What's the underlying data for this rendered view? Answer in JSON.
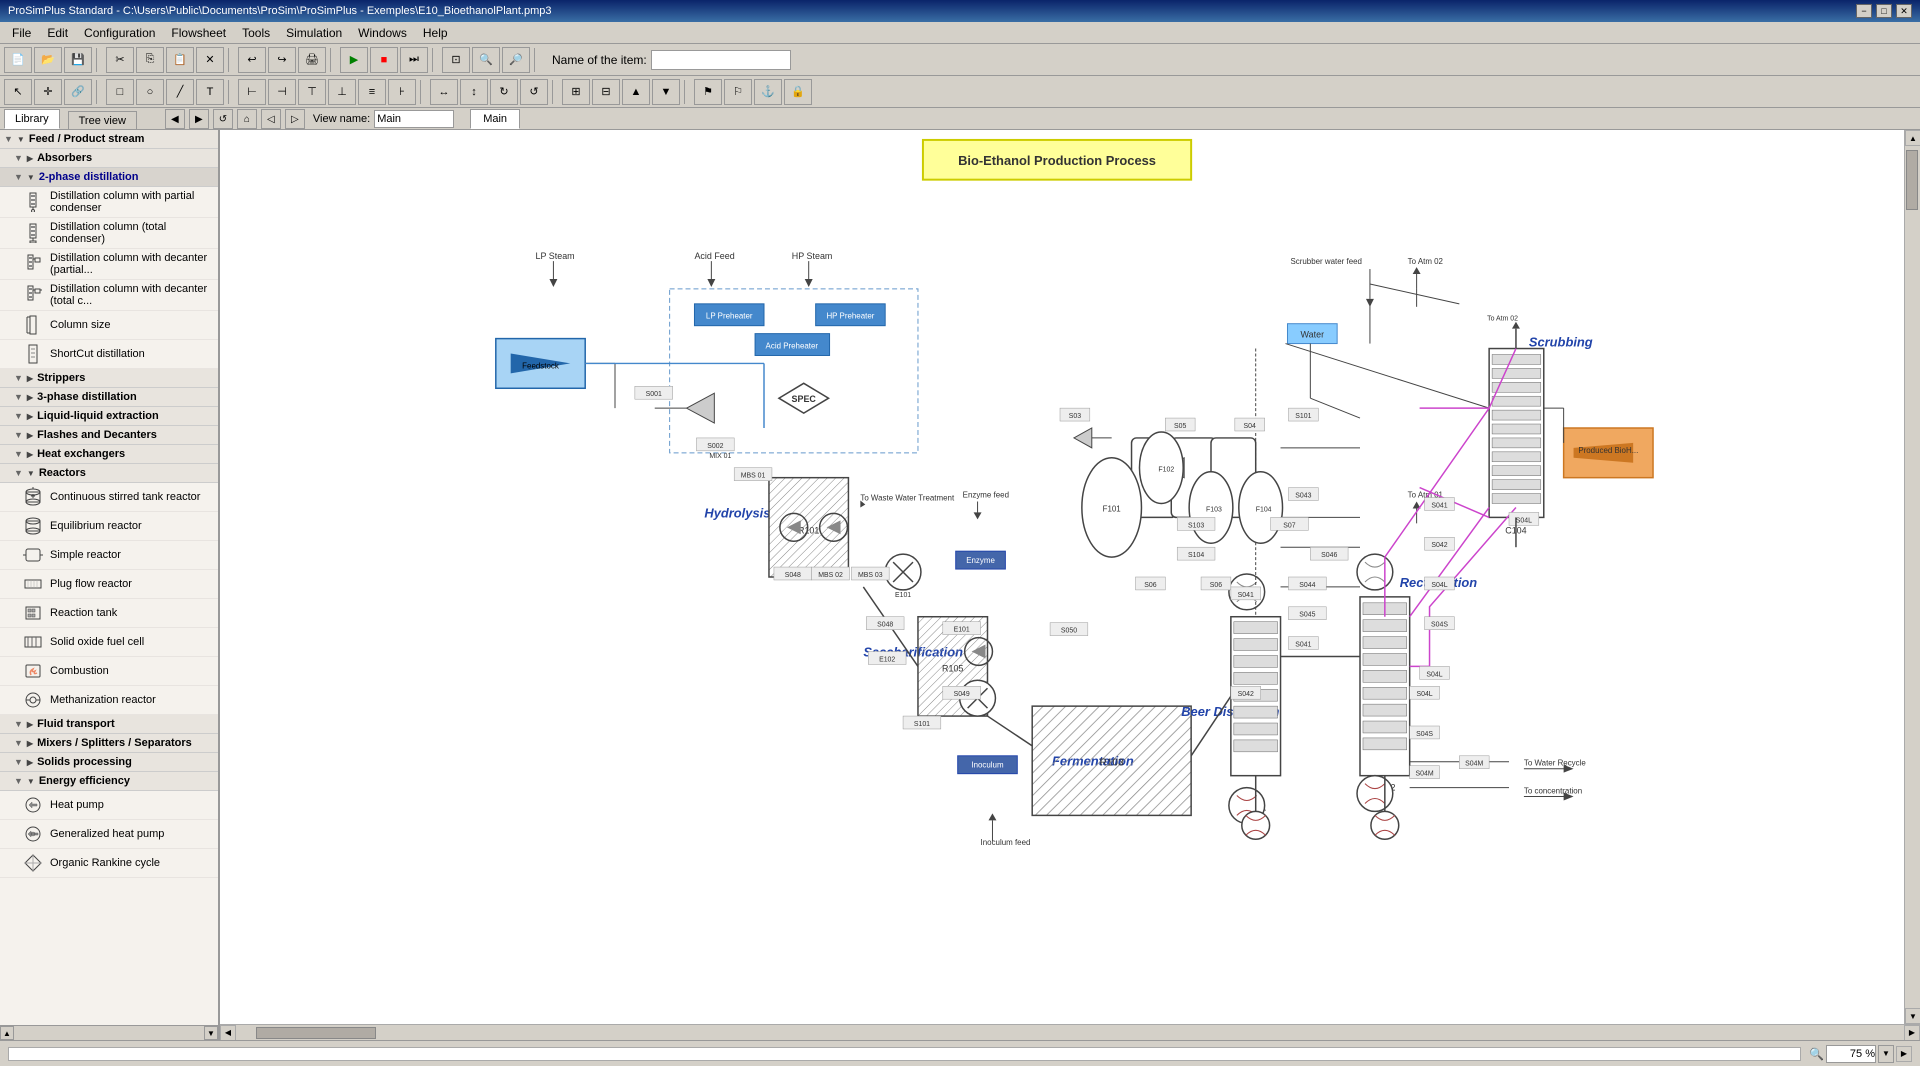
{
  "titlebar": {
    "title": "ProSimPlus Standard - C:\\Users\\Public\\Documents\\ProSim\\ProSimPlus - Exemples\\E10_BioethanolPlant.pmp3",
    "minimize": "−",
    "restore": "□",
    "close": "✕"
  },
  "menubar": {
    "items": [
      "File",
      "Edit",
      "Configuration",
      "Flowsheet",
      "Tools",
      "Simulation",
      "Windows",
      "Help"
    ]
  },
  "toolbar": {
    "name_of_item_label": "Name of the item:",
    "name_of_item_value": ""
  },
  "tabs": {
    "library_label": "Library",
    "tree_view_label": "Tree view",
    "main_tab_label": "Main"
  },
  "view": {
    "view_name_label": "View name:",
    "view_name_value": "Main"
  },
  "sidebar": {
    "categories": [
      {
        "id": "feed-product",
        "label": "Feed / Product stream",
        "expanded": true,
        "items": []
      },
      {
        "id": "absorbers",
        "label": "Absorbers",
        "expanded": false,
        "items": []
      },
      {
        "id": "2phase-distillation",
        "label": "2-phase distillation",
        "expanded": true,
        "sub": true,
        "items": [
          {
            "id": "dist-partial",
            "label": "Distillation column with partial condenser"
          },
          {
            "id": "dist-total",
            "label": "Distillation column (total condenser)"
          },
          {
            "id": "dist-decanter-partial",
            "label": "Distillation column with decanter (partial..."
          },
          {
            "id": "dist-decanter-total",
            "label": "Distillation column with decanter (total c..."
          },
          {
            "id": "column-size",
            "label": "Column size"
          },
          {
            "id": "shortcut",
            "label": "ShortCut distillation"
          }
        ]
      },
      {
        "id": "strippers",
        "label": "Strippers",
        "expanded": false,
        "items": []
      },
      {
        "id": "3phase-distillation",
        "label": "3-phase distillation",
        "expanded": false,
        "items": []
      },
      {
        "id": "liquid-liquid",
        "label": "Liquid-liquid extraction",
        "expanded": false,
        "items": []
      },
      {
        "id": "flashes",
        "label": "Flashes and Decanters",
        "expanded": false,
        "items": []
      },
      {
        "id": "heat-exchangers",
        "label": "Heat exchangers",
        "expanded": false,
        "items": []
      },
      {
        "id": "reactors",
        "label": "Reactors",
        "expanded": true,
        "items": [
          {
            "id": "cstr",
            "label": "Continuous stirred tank reactor"
          },
          {
            "id": "equilibrium-reactor",
            "label": "Equilibrium reactor"
          },
          {
            "id": "simple-reactor",
            "label": "Simple reactor"
          },
          {
            "id": "plug-flow",
            "label": "Plug flow reactor"
          },
          {
            "id": "reaction-tank",
            "label": "Reaction tank"
          },
          {
            "id": "solid-oxide",
            "label": "Solid oxide fuel cell"
          },
          {
            "id": "combustion",
            "label": "Combustion"
          },
          {
            "id": "methanation",
            "label": "Methanization reactor"
          }
        ]
      },
      {
        "id": "fluid-transport",
        "label": "Fluid transport",
        "expanded": false,
        "items": []
      },
      {
        "id": "mixers-splitters",
        "label": "Mixers / Splitters / Separators",
        "expanded": false,
        "items": []
      },
      {
        "id": "solids-processing",
        "label": "Solids processing",
        "expanded": false,
        "items": []
      },
      {
        "id": "energy-efficiency",
        "label": "Energy efficiency",
        "expanded": true,
        "items": [
          {
            "id": "heat-pump",
            "label": "Heat pump"
          },
          {
            "id": "generalized-heat-pump",
            "label": "Generalized heat pump"
          },
          {
            "id": "organic-rankine",
            "label": "Organic Rankine cycle"
          }
        ]
      }
    ]
  },
  "flowsheet": {
    "title": "Bio-Ethanol Production Process",
    "labels": {
      "hydrolysis": "Hydrolysis",
      "saccharification": "Saccharification",
      "fermentation": "Fermentation",
      "beer_distillation": "Beer Distillation",
      "scrubbing": "Scrubbing",
      "rectification": "Rectification",
      "lp_steam": "LP Steam",
      "hp_steam": "HP Steam",
      "acid_feed": "Acid Feed",
      "acid_preheater": "Acid Preheater",
      "lp_preheater": "LP Preheater",
      "hp_preheater": "HP Preheater",
      "enzyme": "Enzyme",
      "inoculum": "Inoculum",
      "inoculum_feed": "Inoculum feed",
      "to_waste_water": "To Waste Water Treatment",
      "enzyme_feed": "Enzyme feed",
      "to_atm_02": "To Atm 02",
      "to_atm_01": "To Atm 01",
      "produced_bioh": "Produced BioH...",
      "to_water_recycle": "To Water Recycle",
      "to_concentration": "To concentration",
      "scrubber_water_feed": "Scrubber water feed",
      "water": "Water"
    }
  },
  "statusbar": {
    "zoom_label": "75 %"
  }
}
